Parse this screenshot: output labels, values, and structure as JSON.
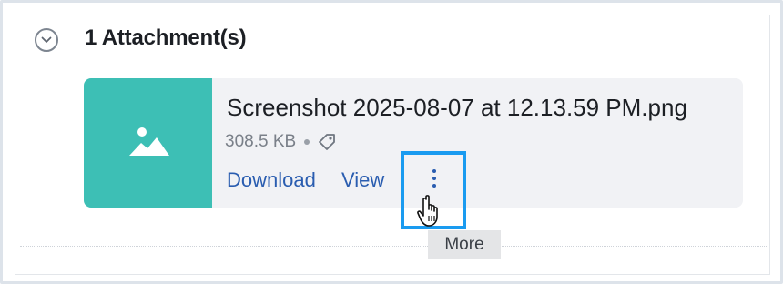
{
  "header": {
    "title": "1 Attachment(s)",
    "toggle_icon": "chevron-down-circle-icon"
  },
  "attachment": {
    "file_name": "Screenshot 2025-08-07 at 12.13.59 PM.png",
    "file_size": "308.5 KB",
    "thumbnail_icon": "image-icon",
    "thumbnail_color": "#3dbfb5",
    "tag_icon": "tag-icon",
    "actions": {
      "download_label": "Download",
      "view_label": "View",
      "more_icon": "kebab-menu-icon"
    }
  },
  "tooltip": {
    "text": "More"
  },
  "colors": {
    "link": "#2a5db0",
    "highlight": "#1a9bf0",
    "card_bg": "#f1f2f5"
  }
}
